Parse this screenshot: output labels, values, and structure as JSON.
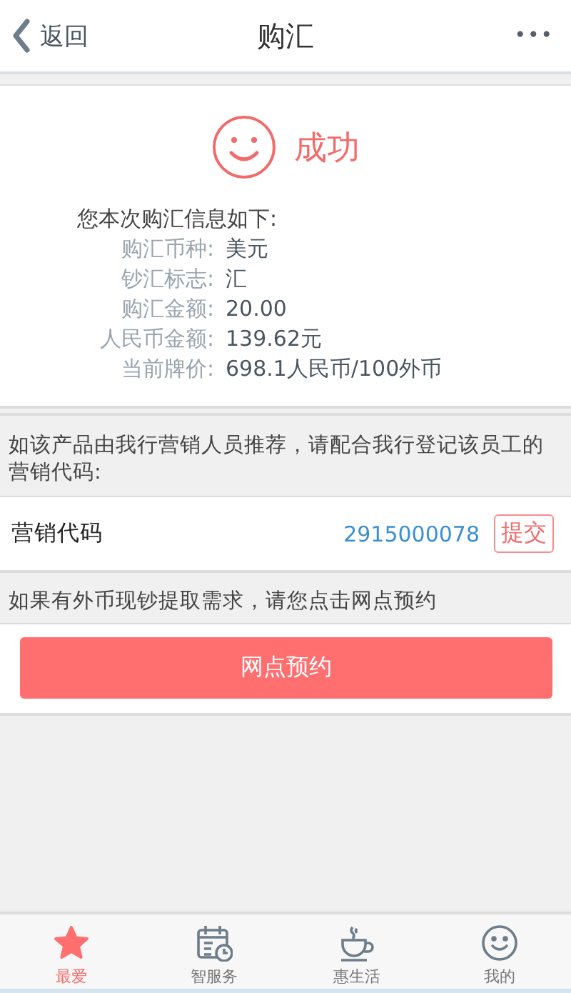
{
  "header": {
    "back_label": "返回",
    "title": "购汇",
    "more": "•••"
  },
  "result": {
    "status": "成功",
    "intro": "您本次购汇信息如下:",
    "fields": [
      {
        "label": "购汇币种:",
        "value": "美元"
      },
      {
        "label": "钞汇标志:",
        "value": "汇"
      },
      {
        "label": "购汇金额:",
        "value": "20.00"
      },
      {
        "label": "人民币金额:",
        "value": "139.62元"
      },
      {
        "label": "当前牌价:",
        "value": "698.1人民币/100外币"
      }
    ]
  },
  "referral": {
    "note": "如该产品由我行营销人员推荐，请配合我行登记该员工的营销代码:",
    "label": "营销代码",
    "code": "2915000078",
    "submit": "提交"
  },
  "branch": {
    "note": "如果有外币现钞提取需求，请您点击网点预约",
    "button": "网点预约"
  },
  "tabs": [
    {
      "kind": "star",
      "label": "最爱",
      "selected": true
    },
    {
      "kind": "calendar",
      "label": "智服务",
      "selected": false
    },
    {
      "kind": "cup",
      "label": "惠生活",
      "selected": false
    },
    {
      "kind": "smile",
      "label": "我的",
      "selected": false
    }
  ]
}
